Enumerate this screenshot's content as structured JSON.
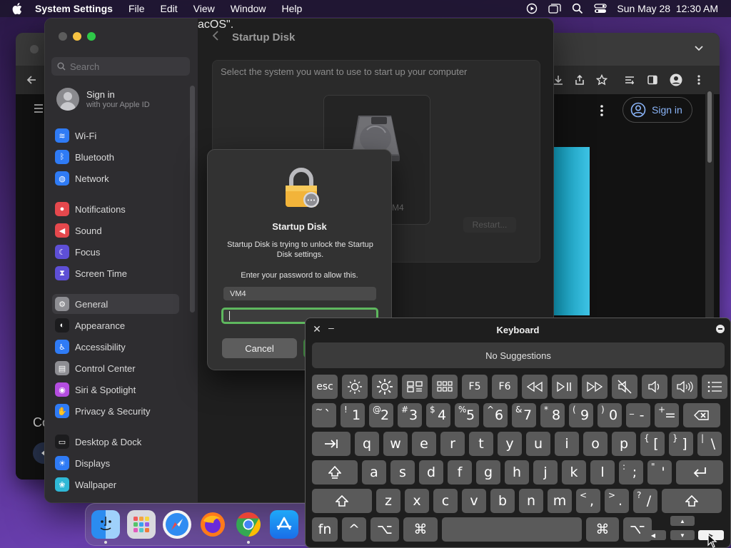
{
  "menubar": {
    "app": "System Settings",
    "menus": [
      "File",
      "Edit",
      "View",
      "Window",
      "Help"
    ],
    "datetime": "Sun May 28  12:30 AM"
  },
  "chrome": {
    "signin": "Sign in",
    "partial_text": "Co"
  },
  "settings": {
    "search_placeholder": "Search",
    "account": {
      "name": "Sign in",
      "sub": "with your Apple ID"
    },
    "sidebar": [
      {
        "label": "Wi-Fi",
        "icon": "wifi-icon",
        "color": "#2f7bf5"
      },
      {
        "label": "Bluetooth",
        "icon": "bluetooth-icon",
        "color": "#2f7bf5"
      },
      {
        "label": "Network",
        "icon": "network-icon",
        "color": "#2f7bf5"
      },
      {
        "label": "Notifications",
        "icon": "bell-icon",
        "color": "#e5484d"
      },
      {
        "label": "Sound",
        "icon": "speaker-icon",
        "color": "#e5484d"
      },
      {
        "label": "Focus",
        "icon": "moon-icon",
        "color": "#5e4fd6"
      },
      {
        "label": "Screen Time",
        "icon": "hourglass-icon",
        "color": "#5e4fd6"
      },
      {
        "label": "General",
        "icon": "gear-icon",
        "color": "#8e8e93"
      },
      {
        "label": "Appearance",
        "icon": "appearance-icon",
        "color": "#1c1c1e"
      },
      {
        "label": "Accessibility",
        "icon": "accessibility-icon",
        "color": "#2f7bf5"
      },
      {
        "label": "Control Center",
        "icon": "control-center-icon",
        "color": "#8e8e93"
      },
      {
        "label": "Siri & Spotlight",
        "icon": "siri-icon",
        "color": "#b44de0"
      },
      {
        "label": "Privacy & Security",
        "icon": "hand-icon",
        "color": "#2f7bf5"
      },
      {
        "label": "Desktop & Dock",
        "icon": "dock-icon",
        "color": "#1c1c1e"
      },
      {
        "label": "Displays",
        "icon": "display-icon",
        "color": "#2f7bf5"
      },
      {
        "label": "Wallpaper",
        "icon": "wallpaper-icon",
        "color": "#2fb8d6"
      }
    ],
    "page_title": "Startup Disk",
    "hint": "Select the system you want to use to start up your computer",
    "disk_label_partial": "M4",
    "os_line_partial": "acOS\".",
    "restart_ghost": "Restart..."
  },
  "dialog": {
    "title": "Startup Disk",
    "message": "Startup Disk is trying to unlock the Startup Disk settings.",
    "prompt": "Enter your password to allow this.",
    "username": "VM4",
    "password": "",
    "cancel": "Cancel"
  },
  "dock": {
    "apps": [
      "Finder",
      "Launchpad",
      "Safari",
      "Firefox",
      "Chrome",
      "App Store"
    ]
  },
  "keyboard": {
    "title": "Keyboard",
    "suggestions": "No Suggestions",
    "fn_row": [
      "esc",
      "brightness-down-icon",
      "brightness-up-icon",
      "mission-control-icon",
      "launchpad-icon",
      "F5",
      "F6",
      "rewind-icon",
      "play-pause-icon",
      "fast-forward-icon",
      "mute-icon",
      "volume-down-icon",
      "volume-up-icon",
      "menu-icon"
    ],
    "num_row": [
      {
        "sup": "~",
        "main": "`"
      },
      {
        "sup": "!",
        "main": "1"
      },
      {
        "sup": "@",
        "main": "2"
      },
      {
        "sup": "#",
        "main": "3"
      },
      {
        "sup": "$",
        "main": "4"
      },
      {
        "sup": "%",
        "main": "5"
      },
      {
        "sup": "^",
        "main": "6"
      },
      {
        "sup": "&",
        "main": "7"
      },
      {
        "sup": "*",
        "main": "8"
      },
      {
        "sup": "(",
        "main": "9"
      },
      {
        "sup": ")",
        "main": "0"
      },
      {
        "sup": "_",
        "main": "-"
      },
      {
        "sup": "+",
        "main": "="
      }
    ],
    "row_q": [
      "q",
      "w",
      "e",
      "r",
      "t",
      "y",
      "u",
      "i",
      "o",
      "p"
    ],
    "row_q_extra": [
      {
        "sup": "{",
        "main": "["
      },
      {
        "sup": "}",
        "main": "]"
      },
      {
        "sup": "|",
        "main": "\\"
      }
    ],
    "row_a": [
      "a",
      "s",
      "d",
      "f",
      "g",
      "h",
      "j",
      "k",
      "l"
    ],
    "row_a_extra": [
      {
        "sup": ":",
        "main": ";"
      },
      {
        "sup": "\"",
        "main": "'"
      }
    ],
    "row_z": [
      "z",
      "x",
      "c",
      "v",
      "b",
      "n",
      "m"
    ],
    "row_z_extra": [
      {
        "sup": "<",
        "main": ","
      },
      {
        "sup": ">",
        "main": "."
      },
      {
        "sup": "?",
        "main": "/"
      }
    ],
    "bottom": {
      "fn": "fn",
      "ctrl": "^",
      "opt": "⌥",
      "cmd": "⌘"
    }
  }
}
